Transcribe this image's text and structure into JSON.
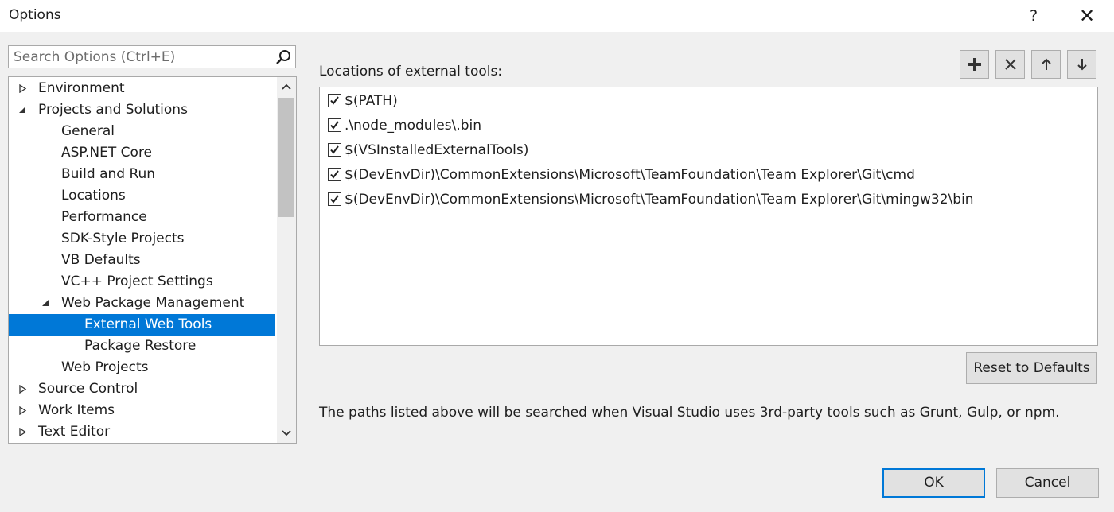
{
  "window": {
    "title": "Options",
    "help_label": "?",
    "close_label": "✕"
  },
  "search": {
    "placeholder": "Search Options (Ctrl+E)",
    "value": ""
  },
  "tree": {
    "items": [
      {
        "label": "Environment",
        "expander": "collapsed"
      },
      {
        "label": "Projects and Solutions",
        "expander": "expanded"
      },
      {
        "label": "General",
        "expander": "none"
      },
      {
        "label": "ASP.NET Core",
        "expander": "none"
      },
      {
        "label": "Build and Run",
        "expander": "none"
      },
      {
        "label": "Locations",
        "expander": "none"
      },
      {
        "label": "Performance",
        "expander": "none"
      },
      {
        "label": "SDK-Style Projects",
        "expander": "none"
      },
      {
        "label": "VB Defaults",
        "expander": "none"
      },
      {
        "label": "VC++ Project Settings",
        "expander": "none"
      },
      {
        "label": "Web Package Management",
        "expander": "expanded"
      },
      {
        "label": "External Web Tools",
        "expander": "none",
        "selected": true
      },
      {
        "label": "Package Restore",
        "expander": "none"
      },
      {
        "label": "Web Projects",
        "expander": "none"
      },
      {
        "label": "Source Control",
        "expander": "collapsed"
      },
      {
        "label": "Work Items",
        "expander": "collapsed"
      },
      {
        "label": "Text Editor",
        "expander": "collapsed"
      }
    ]
  },
  "main": {
    "list_title": "Locations of external tools:",
    "toolbar": {
      "add_icon": "add-icon",
      "delete_icon": "delete-icon",
      "move_up_icon": "arrow-up-icon",
      "move_down_icon": "arrow-down-icon"
    },
    "locations": [
      {
        "path": "$(PATH)",
        "checked": true
      },
      {
        "path": ".\\node_modules\\.bin",
        "checked": true
      },
      {
        "path": "$(VSInstalledExternalTools)",
        "checked": true
      },
      {
        "path": "$(DevEnvDir)\\CommonExtensions\\Microsoft\\TeamFoundation\\Team Explorer\\Git\\cmd",
        "checked": true
      },
      {
        "path": "$(DevEnvDir)\\CommonExtensions\\Microsoft\\TeamFoundation\\Team Explorer\\Git\\mingw32\\bin",
        "checked": true
      }
    ],
    "reset_label": "Reset to Defaults",
    "description": "The paths listed above will be searched when Visual Studio uses 3rd-party tools such as Grunt, Gulp, or npm."
  },
  "footer": {
    "ok_label": "OK",
    "cancel_label": "Cancel"
  },
  "colors": {
    "selection": "#0078d7",
    "window_bg": "#f0f0f0",
    "button_bg": "#e1e1e1"
  }
}
